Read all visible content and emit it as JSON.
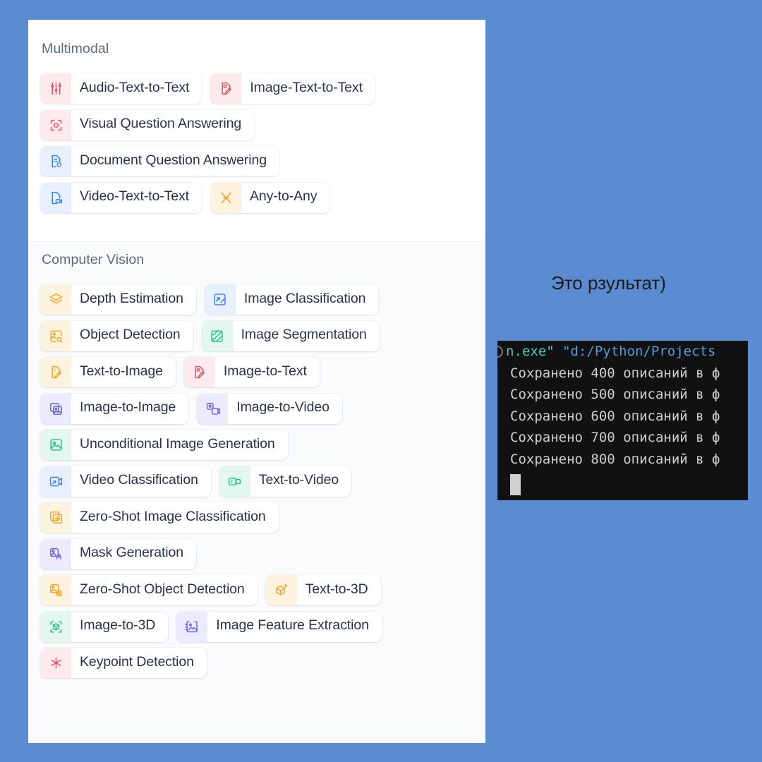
{
  "background_color": "#5b8bd0",
  "panel": {
    "background_color": "#ffffff",
    "sections": [
      {
        "id": "multimodal",
        "title": "Multimodal",
        "rows": [
          [
            {
              "label": "Audio-Text-to-Text",
              "icon": "audio-sliders-icon",
              "tint": "t-red",
              "color": "#ef4e5e"
            },
            {
              "label": "Image-Text-to-Text",
              "icon": "image-text-doc-icon",
              "tint": "t-red",
              "color": "#ef4e5e"
            }
          ],
          [
            {
              "label": "Visual Question Answering",
              "icon": "camera-question-icon",
              "tint": "t-red",
              "color": "#ef4e5e"
            }
          ],
          [
            {
              "label": "Document Question Answering",
              "icon": "document-question-icon",
              "tint": "t-blue",
              "color": "#3b82f6"
            }
          ],
          [
            {
              "label": "Video-Text-to-Text",
              "icon": "video-document-icon",
              "tint": "t-blue",
              "color": "#3b82f6"
            },
            {
              "label": "Any-to-Any",
              "icon": "any-to-any-icon",
              "tint": "t-amber",
              "color": "#f5a623"
            }
          ]
        ]
      },
      {
        "id": "computer-vision",
        "title": "Computer Vision",
        "rows": [
          [
            {
              "label": "Depth Estimation",
              "icon": "layers-icon",
              "tint": "t-amber",
              "color": "#f5a623"
            },
            {
              "label": "Image Classification",
              "icon": "image-arrow-icon",
              "tint": "t-blue",
              "color": "#3b82f6"
            }
          ],
          [
            {
              "label": "Object Detection",
              "icon": "object-detect-icon",
              "tint": "t-amber",
              "color": "#f5a623"
            },
            {
              "label": "Image Segmentation",
              "icon": "segmentation-icon",
              "tint": "t-green",
              "color": "#22c08b"
            }
          ],
          [
            {
              "label": "Text-to-Image",
              "icon": "text-image-pencil-icon",
              "tint": "t-amber",
              "color": "#f5a623"
            },
            {
              "label": "Image-to-Text",
              "icon": "image-text-doc-icon",
              "tint": "t-red",
              "color": "#ef4e5e"
            }
          ],
          [
            {
              "label": "Image-to-Image",
              "icon": "image-to-image-icon",
              "tint": "t-indigo",
              "color": "#6c63e8"
            },
            {
              "label": "Image-to-Video",
              "icon": "image-to-video-icon",
              "tint": "t-indigo",
              "color": "#6c63e8"
            }
          ],
          [
            {
              "label": "Unconditional Image Generation",
              "icon": "image-sparkle-icon",
              "tint": "t-green",
              "color": "#22c08b"
            }
          ],
          [
            {
              "label": "Video Classification",
              "icon": "video-arrow-icon",
              "tint": "t-blue",
              "color": "#3b82f6"
            },
            {
              "label": "Text-to-Video",
              "icon": "text-to-video-icon",
              "tint": "t-green",
              "color": "#22c08b"
            }
          ],
          [
            {
              "label": "Zero-Shot Image Classification",
              "icon": "zero-shot-image-icon",
              "tint": "t-amber",
              "color": "#f5a623"
            }
          ],
          [
            {
              "label": "Mask Generation",
              "icon": "mask-generation-icon",
              "tint": "t-indigo",
              "color": "#6c63e8"
            }
          ],
          [
            {
              "label": "Zero-Shot Object Detection",
              "icon": "zero-shot-object-icon",
              "tint": "t-amber",
              "color": "#f5a623"
            },
            {
              "label": "Text-to-3D",
              "icon": "cube-sparkle-icon",
              "tint": "t-amber",
              "color": "#f5a623"
            }
          ],
          [
            {
              "label": "Image-to-3D",
              "icon": "image-to-3d-icon",
              "tint": "t-green",
              "color": "#22c08b"
            },
            {
              "label": "Image Feature Extraction",
              "icon": "feature-extraction-icon",
              "tint": "t-indigo",
              "color": "#6c63e8"
            }
          ],
          [
            {
              "label": "Keypoint Detection",
              "icon": "asterisk-icon",
              "tint": "t-red",
              "color": "#ef4e5e"
            }
          ]
        ]
      }
    ]
  },
  "caption": {
    "text": "Это рзультат)"
  },
  "terminal": {
    "background_color": "#101112",
    "lines": [
      {
        "type": "command",
        "parts": [
          {
            "text": "n.exe\"",
            "color": "#4ec9b0"
          },
          {
            "text": " ",
            "color": "#d4d4d4"
          },
          {
            "text": "\"d:/Python/Projects",
            "color": "#569cd6"
          }
        ]
      },
      {
        "type": "output",
        "prefix": "Сохранено",
        "count": "400",
        "suffix": "описаний в ф"
      },
      {
        "type": "output",
        "prefix": "Сохранено",
        "count": "500",
        "suffix": "описаний в ф"
      },
      {
        "type": "output",
        "prefix": "Сохранено",
        "count": "600",
        "suffix": "описаний в ф"
      },
      {
        "type": "output",
        "prefix": "Сохранено",
        "count": "700",
        "suffix": "описаний в ф"
      },
      {
        "type": "output",
        "prefix": "Сохранено",
        "count": "800",
        "suffix": "описаний в ф"
      }
    ],
    "cursor": "block"
  }
}
